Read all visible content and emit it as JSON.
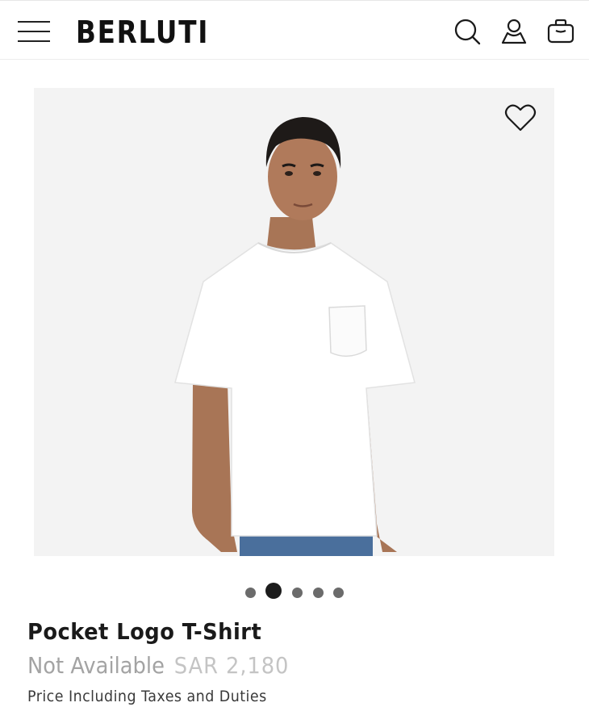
{
  "header": {
    "brand": "BERLUTI",
    "icons": {
      "menu": "hamburger-menu-icon",
      "search": "search-icon",
      "account": "user-icon",
      "bag": "shopping-bag-icon"
    }
  },
  "gallery": {
    "wishlist_icon": "heart-icon",
    "image_alt": "Model wearing a white pocket logo t-shirt",
    "slides_total": 5,
    "active_slide": 2,
    "colors": {
      "background": "#f3f3f3",
      "shirt": "#ffffff",
      "jeans": "#4a6f9c"
    }
  },
  "product": {
    "name": "Pocket Logo T-Shirt",
    "availability": "Not Available",
    "price": "SAR 2,180",
    "tax_note": "Price Including Taxes and Duties"
  }
}
